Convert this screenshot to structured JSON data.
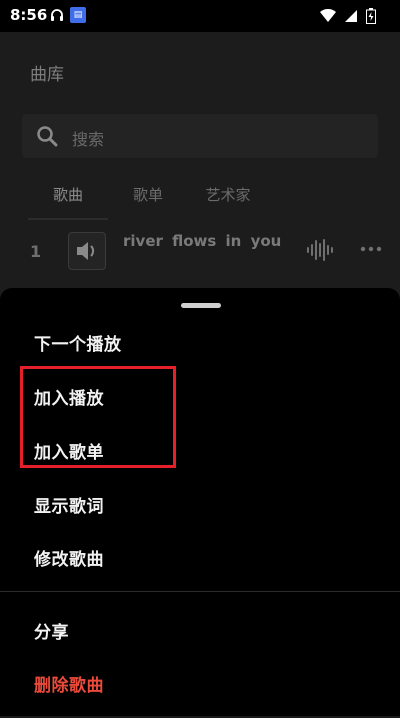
{
  "status_bar": {
    "time": "8:56",
    "icons": [
      "headset-icon",
      "app-notification-icon",
      "wifi-icon",
      "cell-signal-icon",
      "battery-icon"
    ]
  },
  "library": {
    "title": "曲库",
    "search_placeholder": "搜索",
    "tabs": [
      {
        "label": "歌曲",
        "active": true
      },
      {
        "label": "歌单",
        "active": false
      },
      {
        "label": "艺术家",
        "active": false
      }
    ],
    "songs": [
      {
        "index": "1",
        "title": "river flows in you"
      }
    ]
  },
  "sheet": {
    "items": [
      {
        "label": "下一个播放"
      },
      {
        "label": "加入播放"
      },
      {
        "label": "加入歌单"
      },
      {
        "label": "显示歌词"
      },
      {
        "label": "修改歌曲"
      },
      {
        "label": "分享"
      },
      {
        "label": "删除歌曲"
      }
    ]
  },
  "colors": {
    "sheet_background": "#000000",
    "danger_text": "#ec4a3a",
    "highlight_border": "#e5202a"
  }
}
